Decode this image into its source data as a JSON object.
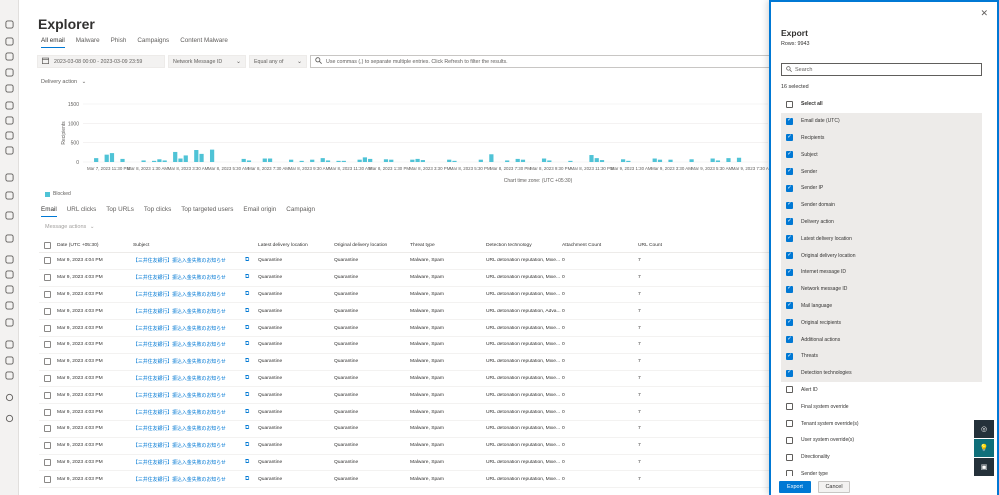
{
  "page": {
    "title": "Explorer"
  },
  "tabs": [
    {
      "label": "All email",
      "active": true
    },
    {
      "label": "Malware",
      "active": false
    },
    {
      "label": "Phish",
      "active": false
    },
    {
      "label": "Campaigns",
      "active": false
    },
    {
      "label": "Content Malware",
      "active": false
    }
  ],
  "filters": {
    "date_range": "2023-03-08 00:00 - 2023-03-09 23:59",
    "field": "Network Message ID",
    "operator": "Equal any of",
    "query_placeholder": "Use commas (,) to separate multiple entries. Click Refresh to filter the results."
  },
  "delivery_action_label": "Delivery action",
  "chart_data": {
    "type": "bar",
    "ylabel": "Recipients",
    "xlabel": "Chart time zone: (UTC +05:30)",
    "ylim": [
      0,
      1500
    ],
    "yticks": [
      "1500",
      "1000",
      "500",
      "0"
    ],
    "ytick_values": [
      1500,
      1000,
      500,
      0
    ],
    "xtick_labels": [
      "Mar 7, 2023 11:30 PM",
      "Mar 8, 2023 1:30 AM",
      "Mar 8, 2023 3:30 AM",
      "Mar 8, 2023 5:30 AM",
      "Mar 8, 2023 7:30 AM",
      "Mar 8, 2023 9:30 AM",
      "Mar 8, 2023 11:30 AM",
      "Mar 8, 2023 1:30 PM",
      "Mar 8, 2023 3:30 PM",
      "Mar 8, 2023 5:30 PM",
      "Mar 8, 2023 7:30 PM",
      "Mar 8, 2023 9:30 PM",
      "Mar 8, 2023 11:30 PM",
      "Mar 9, 2023 1:30 AM",
      "Mar 9, 2023 3:30 AM",
      "Mar 9, 2023 5:30 AM",
      "Mar 9, 2023 7:30 AM"
    ],
    "series": [
      {
        "name": "Blocked",
        "color": "#4fc3d6",
        "values": [
          0,
          0,
          100,
          0,
          190,
          230,
          0,
          80,
          0,
          0,
          0,
          40,
          0,
          30,
          70,
          40,
          0,
          260,
          90,
          170,
          0,
          310,
          210,
          0,
          320,
          0,
          0,
          0,
          0,
          0,
          80,
          40,
          0,
          0,
          90,
          90,
          0,
          0,
          0,
          60,
          0,
          30,
          0,
          60,
          0,
          100,
          40,
          0,
          30,
          30,
          0,
          0,
          60,
          120,
          80,
          0,
          0,
          70,
          60,
          0,
          0,
          0,
          60,
          80,
          50,
          0,
          0,
          0,
          0,
          60,
          30,
          0,
          0,
          0,
          0,
          60,
          0,
          200,
          0,
          0,
          40,
          0,
          80,
          60,
          0,
          0,
          0,
          90,
          40,
          0,
          0,
          0,
          30,
          0,
          0,
          0,
          180,
          100,
          50,
          0,
          0,
          0,
          70,
          30,
          0,
          0,
          0,
          0,
          90,
          60,
          0,
          60,
          0,
          0,
          0,
          70,
          0,
          0,
          0,
          90,
          40,
          0,
          100,
          0,
          110,
          0,
          0,
          0,
          0,
          0
        ]
      }
    ]
  },
  "subtabs": [
    {
      "label": "Email",
      "active": true
    },
    {
      "label": "URL clicks",
      "active": false
    },
    {
      "label": "Top URLs",
      "active": false
    },
    {
      "label": "Top clicks",
      "active": false
    },
    {
      "label": "Top targeted users",
      "active": false
    },
    {
      "label": "Email origin",
      "active": false
    },
    {
      "label": "Campaign",
      "active": false
    }
  ],
  "message_actions_label": "Message actions",
  "table": {
    "columns": [
      "Date (UTC +05:30)",
      "Subject",
      "Latest delivery location",
      "Original delivery location",
      "Threat type",
      "Detection technology",
      "Attachment Count",
      "URL Count"
    ],
    "rows": [
      {
        "date": "Mar 9, 2023 4:04 PM",
        "subject": "【三井住友銀行】振込入金失敗のお知らせ",
        "latest": "Quarantine",
        "original": "Quarantine",
        "threat": "Malware, Spam",
        "tech": "URL detonation reputation, Mixe...",
        "att": "0",
        "url": "7"
      },
      {
        "date": "Mar 9, 2023 4:03 PM",
        "subject": "【三井住友銀行】振込入金失敗のお知らせ",
        "latest": "Quarantine",
        "original": "Quarantine",
        "threat": "Malware, Spam",
        "tech": "URL detonation reputation, Mixe...",
        "att": "0",
        "url": "7"
      },
      {
        "date": "Mar 9, 2023 4:03 PM",
        "subject": "【三井住友銀行】振込入金失敗のお知らせ",
        "latest": "Quarantine",
        "original": "Quarantine",
        "threat": "Malware, Spam",
        "tech": "URL detonation reputation, Mixe...",
        "att": "0",
        "url": "7"
      },
      {
        "date": "Mar 9, 2023 4:03 PM",
        "subject": "【三井住友銀行】振込入金失敗のお知らせ",
        "latest": "Quarantine",
        "original": "Quarantine",
        "threat": "Malware, Spam",
        "tech": "URL detonation reputation, Adva...",
        "att": "0",
        "url": "7"
      },
      {
        "date": "Mar 9, 2023 4:03 PM",
        "subject": "【三井住友銀行】振込入金失敗のお知らせ",
        "latest": "Quarantine",
        "original": "Quarantine",
        "threat": "Malware, Spam",
        "tech": "URL detonation reputation, Mixe...",
        "att": "0",
        "url": "7"
      },
      {
        "date": "Mar 9, 2023 4:03 PM",
        "subject": "【三井住友銀行】振込入金失敗のお知らせ",
        "latest": "Quarantine",
        "original": "Quarantine",
        "threat": "Malware, Spam",
        "tech": "URL detonation reputation, Mixe...",
        "att": "0",
        "url": "7"
      },
      {
        "date": "Mar 9, 2023 4:03 PM",
        "subject": "【三井住友銀行】振込入金失敗のお知らせ",
        "latest": "Quarantine",
        "original": "Quarantine",
        "threat": "Malware, Spam",
        "tech": "URL detonation reputation, Mixe...",
        "att": "0",
        "url": "7"
      },
      {
        "date": "Mar 9, 2023 4:03 PM",
        "subject": "【三井住友銀行】振込入金失敗のお知らせ",
        "latest": "Quarantine",
        "original": "Quarantine",
        "threat": "Malware, Spam",
        "tech": "URL detonation reputation, Mixe...",
        "att": "0",
        "url": "7"
      },
      {
        "date": "Mar 9, 2023 4:03 PM",
        "subject": "【三井住友銀行】振込入金失敗のお知らせ",
        "latest": "Quarantine",
        "original": "Quarantine",
        "threat": "Malware, Spam",
        "tech": "URL detonation reputation, Mixe...",
        "att": "0",
        "url": "7"
      },
      {
        "date": "Mar 9, 2023 4:03 PM",
        "subject": "【三井住友銀行】振込入金失敗のお知らせ",
        "latest": "Quarantine",
        "original": "Quarantine",
        "threat": "Malware, Spam",
        "tech": "URL detonation reputation, Mixe...",
        "att": "0",
        "url": "7"
      },
      {
        "date": "Mar 9, 2023 4:03 PM",
        "subject": "【三井住友銀行】振込入金失敗のお知らせ",
        "latest": "Quarantine",
        "original": "Quarantine",
        "threat": "Malware, Spam",
        "tech": "URL detonation reputation, Mixe...",
        "att": "0",
        "url": "7"
      },
      {
        "date": "Mar 9, 2023 4:03 PM",
        "subject": "【三井住友銀行】振込入金失敗のお知らせ",
        "latest": "Quarantine",
        "original": "Quarantine",
        "threat": "Malware, Spam",
        "tech": "URL detonation reputation, Mixe...",
        "att": "0",
        "url": "7"
      },
      {
        "date": "Mar 9, 2023 4:03 PM",
        "subject": "【三井住友銀行】振込入金失敗のお知らせ",
        "latest": "Quarantine",
        "original": "Quarantine",
        "threat": "Malware, Spam",
        "tech": "URL detonation reputation, Mixe...",
        "att": "0",
        "url": "7"
      },
      {
        "date": "Mar 9, 2023 4:03 PM",
        "subject": "【三井住友銀行】振込入金失敗のお知らせ",
        "latest": "Quarantine",
        "original": "Quarantine",
        "threat": "Malware, Spam",
        "tech": "URL detonation reputation, Mixe...",
        "att": "0",
        "url": "7"
      }
    ]
  },
  "export_panel": {
    "title": "Export",
    "rows_label": "Rows: 9943",
    "search_placeholder": "Search",
    "selected_label": "16 selected",
    "select_all_label": "Select all",
    "items": [
      {
        "label": "Email date (UTC)",
        "checked": true
      },
      {
        "label": "Recipients",
        "checked": true
      },
      {
        "label": "Subject",
        "checked": true
      },
      {
        "label": "Sender",
        "checked": true
      },
      {
        "label": "Sender IP",
        "checked": true
      },
      {
        "label": "Sender domain",
        "checked": true
      },
      {
        "label": "Delivery action",
        "checked": true
      },
      {
        "label": "Latest delivery location",
        "checked": true
      },
      {
        "label": "Original delivery location",
        "checked": true
      },
      {
        "label": "Internet message ID",
        "checked": true
      },
      {
        "label": "Network message ID",
        "checked": true
      },
      {
        "label": "Mail language",
        "checked": true
      },
      {
        "label": "Original recipients",
        "checked": true
      },
      {
        "label": "Additional actions",
        "checked": true
      },
      {
        "label": "Threats",
        "checked": true
      },
      {
        "label": "Detection technologies",
        "checked": true
      },
      {
        "label": "Alert ID",
        "checked": false
      },
      {
        "label": "Final system override",
        "checked": false
      },
      {
        "label": "Tenant system override(s)",
        "checked": false
      },
      {
        "label": "User system override(s)",
        "checked": false
      },
      {
        "label": "Directionality",
        "checked": false
      },
      {
        "label": "Sender type",
        "checked": false
      }
    ],
    "export_label": "Export",
    "cancel_label": "Cancel"
  },
  "colors": {
    "accent": "#0078d4",
    "bar": "#4fc3d6",
    "fab": "#24313a",
    "fab_active": "#0f6f7a"
  }
}
